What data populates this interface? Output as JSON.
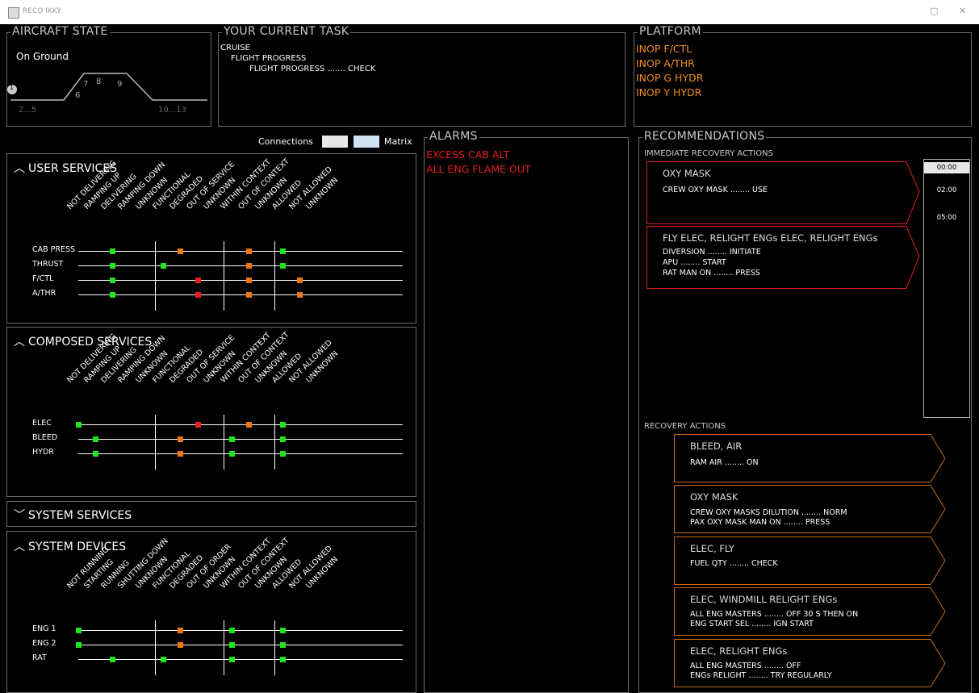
{
  "window": {
    "title": "RECO IKKY",
    "maximize_glyph": "□",
    "close_glyph": "✕"
  },
  "aircraft_state": {
    "title": "AIRCRAFT STATE",
    "status": "On Ground",
    "phase_markers": [
      "1",
      "6",
      "7",
      "8",
      "9"
    ],
    "left_range": "2...5",
    "right_range": "10...13"
  },
  "current_task": {
    "title": "YOUR CURRENT TASK",
    "lines": [
      "CRUISE",
      "FLIGHT PROGRESS",
      "FLIGHT PROGRESS ....... CHECK"
    ]
  },
  "platform": {
    "title": "PLATFORM",
    "items": [
      "INOP F/CTL",
      "INOP A/THR",
      "INOP G HYDR",
      "INOP Y HYDR"
    ],
    "color": "#f08c1e"
  },
  "connections_bar": {
    "connections_label": "Connections",
    "matrix_label": "Matrix"
  },
  "user_services": {
    "title": "USER SERVICES",
    "columns": [
      "NOT DELIVERING",
      "RAMPING UP",
      "DELIVERING",
      "RAMPING DOWN",
      "UNKNOWN",
      "FUNCTIONAL",
      "DEGRADED",
      "OUT OF SERVICE",
      "UNKNOWN",
      "WITHIN CONTEXT",
      "OUT OF CONTEXT",
      "UNKNOWN",
      "ALLOWED",
      "NOT ALLOWED",
      "UNKNOWN"
    ],
    "rows": [
      {
        "label": "CAB PRESS",
        "marks": [
          {
            "col": 2,
            "c": "g"
          },
          {
            "col": 6,
            "c": "o"
          },
          {
            "col": 10,
            "c": "o"
          },
          {
            "col": 12,
            "c": "g"
          }
        ]
      },
      {
        "label": "THRUST",
        "marks": [
          {
            "col": 2,
            "c": "g"
          },
          {
            "col": 5,
            "c": "g"
          },
          {
            "col": 10,
            "c": "o"
          },
          {
            "col": 12,
            "c": "g"
          }
        ]
      },
      {
        "label": "F/CTL",
        "marks": [
          {
            "col": 2,
            "c": "g"
          },
          {
            "col": 7,
            "c": "r"
          },
          {
            "col": 10,
            "c": "o"
          },
          {
            "col": 13,
            "c": "o"
          }
        ]
      },
      {
        "label": "A/THR",
        "marks": [
          {
            "col": 2,
            "c": "g"
          },
          {
            "col": 7,
            "c": "r"
          },
          {
            "col": 10,
            "c": "o"
          },
          {
            "col": 13,
            "c": "o"
          }
        ]
      }
    ]
  },
  "composed_services": {
    "title": "COMPOSED SERVICES",
    "columns": [
      "NOT DELIVERING",
      "RAMPING UP",
      "DELIVERING",
      "RAMPING DOWN",
      "UNKNOWN",
      "FUNCTIONAL",
      "DEGRADED",
      "OUT OF SERVICE",
      "UNKNOWN",
      "WITHIN CONTEXT",
      "OUT OF CONTEXT",
      "UNKNOWN",
      "ALLOWED",
      "NOT ALLOWED",
      "UNKNOWN"
    ],
    "rows": [
      {
        "label": "ELEC",
        "marks": [
          {
            "col": 0,
            "c": "g"
          },
          {
            "col": 7,
            "c": "r"
          },
          {
            "col": 10,
            "c": "o"
          },
          {
            "col": 12,
            "c": "g"
          }
        ]
      },
      {
        "label": "BLEED",
        "marks": [
          {
            "col": 1,
            "c": "g"
          },
          {
            "col": 6,
            "c": "o"
          },
          {
            "col": 9,
            "c": "g"
          },
          {
            "col": 12,
            "c": "g"
          }
        ]
      },
      {
        "label": "HYDR",
        "marks": [
          {
            "col": 1,
            "c": "g"
          },
          {
            "col": 6,
            "c": "o"
          },
          {
            "col": 9,
            "c": "g"
          },
          {
            "col": 12,
            "c": "g"
          }
        ]
      }
    ]
  },
  "system_services": {
    "title": "SYSTEM SERVICES"
  },
  "system_devices": {
    "title": "SYSTEM DEVICES",
    "columns": [
      "NOT RUNNING",
      "STARTING",
      "RUNNING",
      "SHUTTING DOWN",
      "UNKNOWN",
      "FUNCTIONAL",
      "DEGRADED",
      "OUT OF ORDER",
      "UNKNOWN",
      "WITHIN CONTEXT",
      "OUT OF CONTEXT",
      "UNKNOWN",
      "ALLOWED",
      "NOT ALLOWED",
      "UNKNOWN"
    ],
    "rows": [
      {
        "label": "ENG 1",
        "marks": [
          {
            "col": 0,
            "c": "g"
          },
          {
            "col": 6,
            "c": "o"
          },
          {
            "col": 9,
            "c": "g"
          },
          {
            "col": 12,
            "c": "g"
          }
        ]
      },
      {
        "label": "ENG 2",
        "marks": [
          {
            "col": 0,
            "c": "g"
          },
          {
            "col": 6,
            "c": "o"
          },
          {
            "col": 9,
            "c": "g"
          },
          {
            "col": 12,
            "c": "g"
          }
        ]
      },
      {
        "label": "RAT",
        "marks": [
          {
            "col": 2,
            "c": "g"
          },
          {
            "col": 5,
            "c": "g"
          },
          {
            "col": 9,
            "c": "g"
          },
          {
            "col": 12,
            "c": "g"
          }
        ]
      }
    ]
  },
  "alarms": {
    "title": "ALARMS",
    "items": [
      "EXCESS CAB ALT",
      "ALL ENG FLAME OUT"
    ],
    "color": "#e61e1e"
  },
  "recommendations": {
    "title": "RECOMMENDATIONS",
    "immediate_title": "IMMEDIATE RECOVERY ACTIONS",
    "immediate": [
      {
        "title": "OXY MASK",
        "lines": [
          "CREW OXY MASK ........ USE"
        ]
      },
      {
        "title": "FLY ELEC, RELIGHT ENGs ELEC, RELIGHT ENGs",
        "lines": [
          "DIVERSION ........ INITIATE",
          "APU ........ START",
          "RAT MAN ON ........ PRESS"
        ]
      }
    ],
    "timers": [
      "00:00",
      "02:00",
      "05:00"
    ],
    "recovery_title": "RECOVERY ACTIONS",
    "recovery": [
      {
        "title": "BLEED, AIR",
        "lines": [
          "RAM AIR ........ ON"
        ]
      },
      {
        "title": "OXY MASK",
        "lines": [
          "CREW OXY MASKS DILUTION ........ NORM",
          "PAX OXY MASK MAN ON ........ PRESS"
        ]
      },
      {
        "title": "ELEC, FLY",
        "lines": [
          "FUEL QTY ........ CHECK"
        ]
      },
      {
        "title": "ELEC, WINDMILL RELIGHT ENGs",
        "lines": [
          "ALL ENG MASTERS ........ OFF 30 S THEN ON",
          "ENG START SEL ........ IGN START"
        ]
      },
      {
        "title": "ELEC, RELIGHT ENGs",
        "lines": [
          "ALL ENG MASTERS ........ OFF",
          "ENGs RELIGHT ........ TRY REGULARLY"
        ]
      }
    ]
  }
}
